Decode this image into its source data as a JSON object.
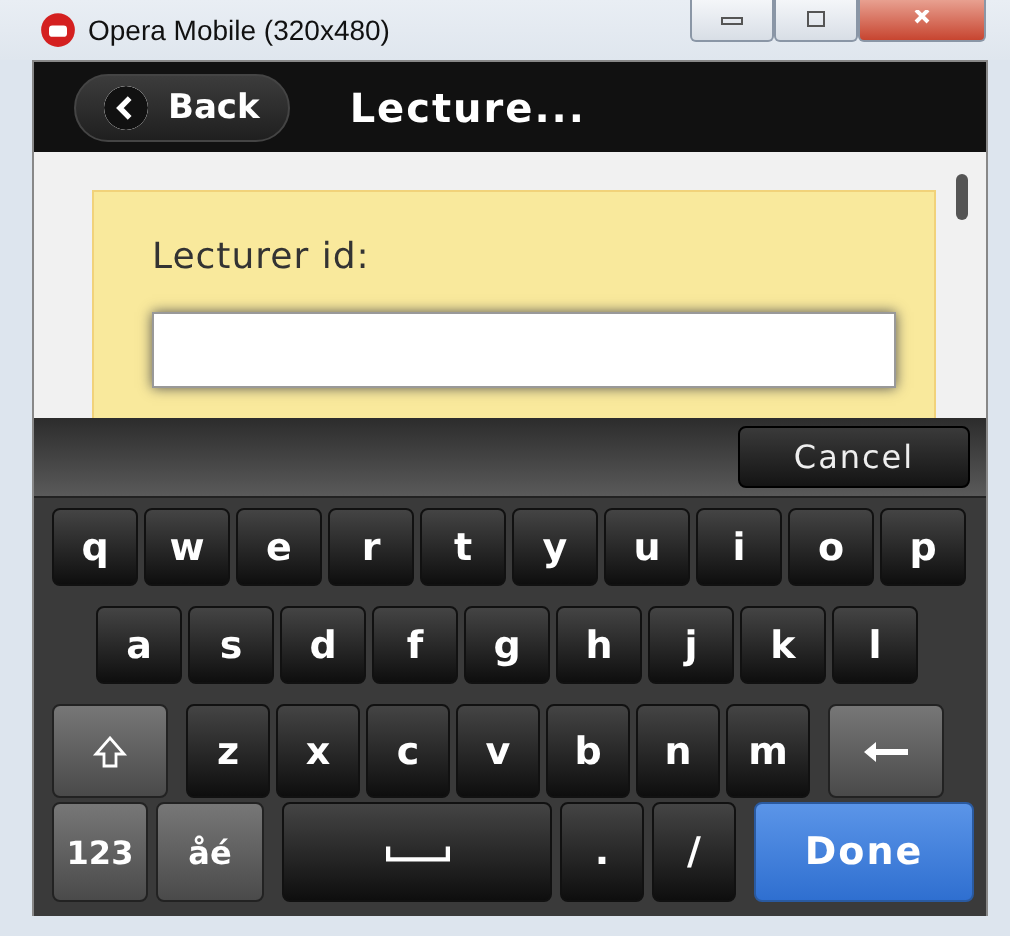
{
  "window": {
    "title": "Opera Mobile (320x480)"
  },
  "header": {
    "back_button": "Back",
    "title": "Lecture..."
  },
  "form": {
    "label": "Lecturer id:"
  },
  "keyboard": {
    "cancel_button": "Cancel",
    "rows": [
      {
        "keys": [
          {
            "kind": "char",
            "label": "q"
          },
          {
            "kind": "char",
            "label": "w"
          },
          {
            "kind": "char",
            "label": "e"
          },
          {
            "kind": "char",
            "label": "r"
          },
          {
            "kind": "char",
            "label": "t"
          },
          {
            "kind": "char",
            "label": "y"
          },
          {
            "kind": "char",
            "label": "u"
          },
          {
            "kind": "char",
            "label": "i"
          },
          {
            "kind": "char",
            "label": "o"
          },
          {
            "kind": "char",
            "label": "p"
          }
        ]
      },
      {
        "keys": [
          {
            "kind": "char",
            "label": "a"
          },
          {
            "kind": "char",
            "label": "s"
          },
          {
            "kind": "char",
            "label": "d"
          },
          {
            "kind": "char",
            "label": "f"
          },
          {
            "kind": "char",
            "label": "g"
          },
          {
            "kind": "char",
            "label": "h"
          },
          {
            "kind": "char",
            "label": "j"
          },
          {
            "kind": "char",
            "label": "k"
          },
          {
            "kind": "char",
            "label": "l"
          }
        ]
      },
      {
        "keys": [
          {
            "kind": "shift"
          },
          {
            "kind": "char",
            "label": "z"
          },
          {
            "kind": "char",
            "label": "x"
          },
          {
            "kind": "char",
            "label": "c"
          },
          {
            "kind": "char",
            "label": "v"
          },
          {
            "kind": "char",
            "label": "b"
          },
          {
            "kind": "char",
            "label": "n"
          },
          {
            "kind": "char",
            "label": "m"
          },
          {
            "kind": "backspace"
          }
        ]
      },
      {
        "keys": [
          {
            "kind": "mode",
            "label": "123"
          },
          {
            "kind": "mode",
            "label": "åé"
          },
          {
            "kind": "space"
          },
          {
            "kind": "char",
            "label": "."
          },
          {
            "kind": "char",
            "label": "/"
          },
          {
            "kind": "done",
            "label": "Done"
          }
        ]
      }
    ]
  }
}
